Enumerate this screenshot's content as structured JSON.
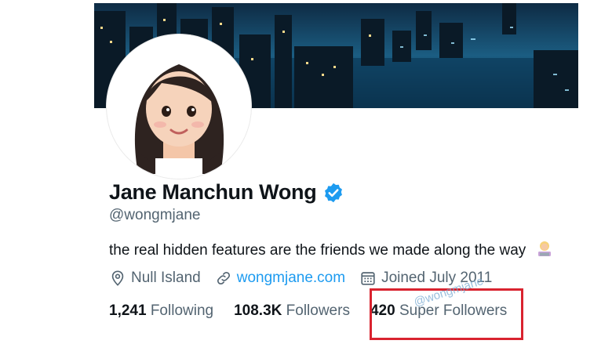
{
  "profile": {
    "name": "Jane Manchun Wong",
    "handle": "@wongmjane",
    "bio": "the real hidden features are the friends we made along the way",
    "bio_emoji": "person-technologist-emoji",
    "verified": true
  },
  "meta": {
    "location": "Null Island",
    "website": "wongmjane.com",
    "joined": "Joined July 2011"
  },
  "stats": {
    "following_count": "1,241",
    "following_label": "Following",
    "followers_count": "108.3K",
    "followers_label": "Followers",
    "super_followers_count": "420",
    "super_followers_label": "Super Followers"
  },
  "watermark": "@wongmjane",
  "colors": {
    "accent": "#1d9bf0",
    "secondary_text": "#536471",
    "highlight_box": "#d9232f"
  }
}
